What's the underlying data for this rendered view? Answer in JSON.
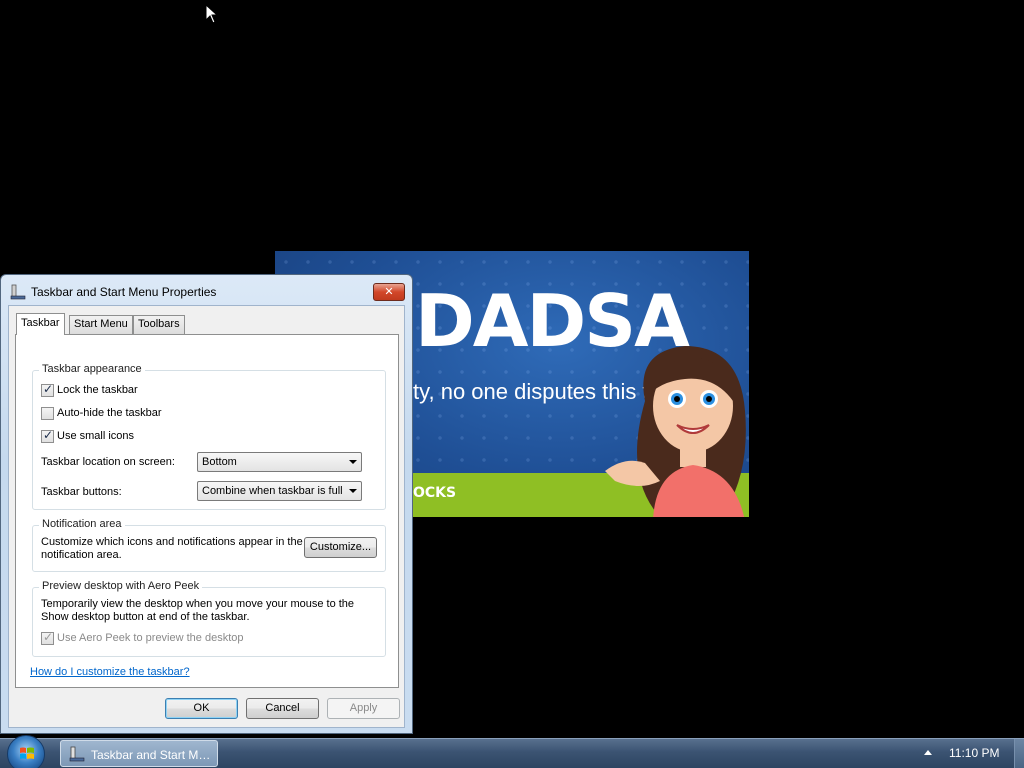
{
  "banner": {
    "title": "DADSA",
    "subtitle": "ty, no one disputes this trait!",
    "footer_text": "OCKS"
  },
  "dialog": {
    "title": "Taskbar and Start Menu Properties",
    "close_label": "✕",
    "tabs": [
      {
        "label": "Taskbar",
        "active": true
      },
      {
        "label": "Start Menu",
        "active": false
      },
      {
        "label": "Toolbars",
        "active": false
      }
    ],
    "appearance": {
      "group_title": "Taskbar appearance",
      "lock_label": "Lock the taskbar",
      "lock_checked": true,
      "autohide_label": "Auto-hide the taskbar",
      "autohide_checked": false,
      "small_icons_label": "Use small icons",
      "small_icons_checked": true,
      "location_label": "Taskbar location on screen:",
      "location_value": "Bottom",
      "buttons_label": "Taskbar buttons:",
      "buttons_value": "Combine when taskbar is full"
    },
    "notification": {
      "group_title": "Notification area",
      "description": "Customize which icons and notifications appear in the notification area.",
      "customize_label": "Customize..."
    },
    "aero_peek": {
      "group_title": "Preview desktop with Aero Peek",
      "description": "Temporarily view the desktop when you move your mouse to the Show desktop button at end of the taskbar.",
      "checkbox_label": "Use Aero Peek to preview the desktop",
      "checked": true,
      "enabled": false
    },
    "help_link": "How do I customize the taskbar?",
    "buttons": {
      "ok": "OK",
      "cancel": "Cancel",
      "apply": "Apply"
    }
  },
  "taskbar": {
    "task_label": "Taskbar and Start Me...",
    "clock": "11:10 PM"
  },
  "colors": {
    "link": "#0066cc",
    "close_button": "#c03a1e",
    "taskbar": "#3b5372",
    "banner_blue": "#1f4f95",
    "banner_green": "#8fbf24"
  }
}
